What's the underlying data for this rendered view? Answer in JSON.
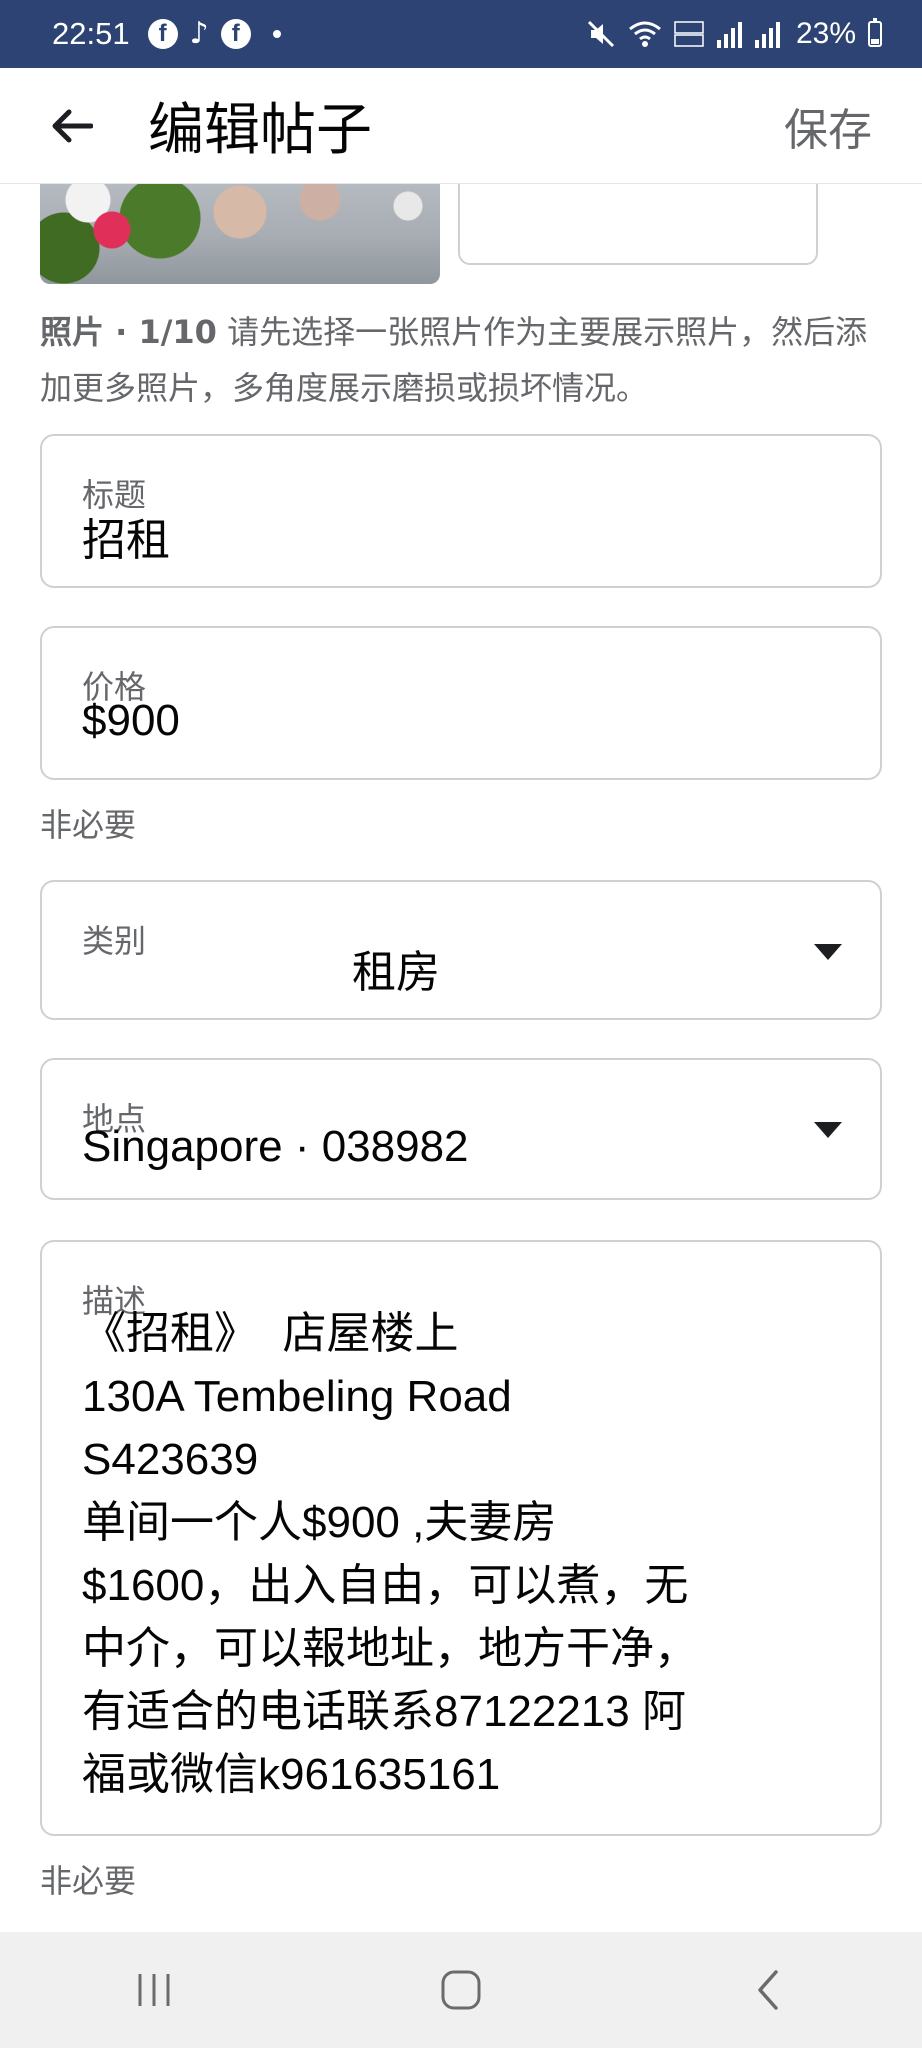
{
  "status_bar": {
    "time": "22:51",
    "battery": "23%",
    "left_icons": [
      "facebook-icon",
      "tiktok-icon",
      "facebook-icon",
      "dot-icon"
    ],
    "right_icons": [
      "mute-icon",
      "wifi-icon",
      "volte-icon",
      "signal-icon",
      "signal-icon",
      "battery-icon"
    ]
  },
  "header": {
    "title": "编辑帖子",
    "save_label": "保存",
    "back_icon": "arrow-left-icon"
  },
  "photos": {
    "help_prefix": "照片 · 1/10",
    "help_text": " 请先选择一张照片作为主要展示照片，然后添加更多照片，多角度展示磨损或损坏情况。"
  },
  "fields": {
    "title": {
      "label": "标题",
      "value": "招租"
    },
    "price": {
      "label": "价格",
      "value": "$900",
      "helper": "非必要"
    },
    "category": {
      "label": "类别",
      "value": "租房"
    },
    "location": {
      "label": "地点",
      "value": "Singapore · 038982"
    },
    "description": {
      "label": "描述",
      "lines": [
        "《招租》  店屋楼上",
        "130A Tembeling Road",
        "S423639",
        "单间一个人$900 ,夫妻房",
        "$1600，出入自由，可以煮，无",
        "中介，可以報地址，地方干净，",
        "有适合的电话联系87122213 阿",
        "福或微信k961635161"
      ],
      "helper": "非必要"
    }
  },
  "nav": {
    "icons": [
      "recent-apps-icon",
      "home-icon",
      "back-icon"
    ]
  },
  "colors": {
    "status_bar": "#2d4373",
    "border": "#ced0d4",
    "secondary_text": "#65676b"
  }
}
